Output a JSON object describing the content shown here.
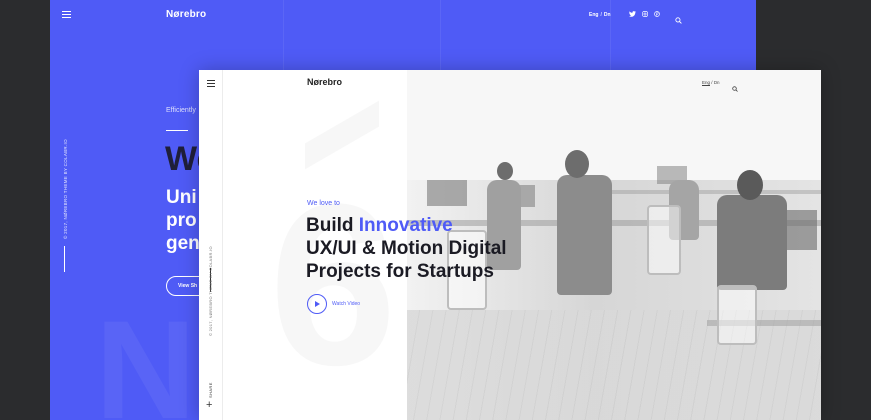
{
  "back_screen": {
    "logo": "Nørebro",
    "lang": {
      "active": "Eng",
      "separator": "/",
      "other": "Dn"
    },
    "social_icons": [
      "twitter-icon",
      "instagram-icon",
      "pinterest-icon"
    ],
    "sidebar_vertical_text": "© 2017, NØREBRO THEME BY COLABR.IO",
    "eyebrow": "Efficiently",
    "big_heading_partial": "We",
    "subheading_lines": [
      "Uni",
      "pro",
      "gen"
    ],
    "button_label": "View Sh",
    "colors": {
      "background": "#4f5bf6",
      "heading_dark": "#1f1f3a"
    }
  },
  "front_screen": {
    "logo": "Nørebro",
    "lang": {
      "active": "Eng",
      "separator": "/",
      "other": "Dn"
    },
    "sidebar_vertical_text": "© 2017, NØREBRO THEME BY COLABR.IO",
    "share_label": "SHARE",
    "eyebrow": "We love to",
    "heading": {
      "line1_prefix": "Build ",
      "line1_accent": "Innovative",
      "line2": "UX/UI & Motion Digital",
      "line3": "Projects for Startups"
    },
    "watch_video_label": "Watch Video",
    "colors": {
      "accent": "#4f5bf6",
      "text": "#1b1b24"
    }
  }
}
